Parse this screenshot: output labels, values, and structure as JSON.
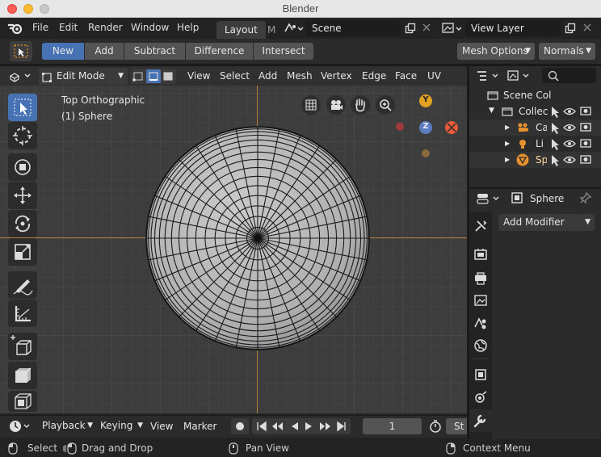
{
  "window": {
    "title": "Blender"
  },
  "menubar": {
    "items": [
      "File",
      "Edit",
      "Render",
      "Window",
      "Help"
    ],
    "workspace_tab": "Layout",
    "workspace_tab_next": "M",
    "scene": "Scene",
    "view_layer": "View Layer"
  },
  "toolheader": {
    "boolean_modes": [
      "New",
      "Add",
      "Subtract",
      "Difference",
      "Intersect"
    ],
    "active_mode": "New",
    "mesh_options": "Mesh Options",
    "normals": "Normals"
  },
  "viewport_header": {
    "mode": "Edit Mode",
    "menus": [
      "View",
      "Select",
      "Add",
      "Mesh",
      "Vertex",
      "Edge",
      "Face",
      "UV"
    ]
  },
  "viewport": {
    "view_name": "Top Orthographic",
    "object_label": "(1) Sphere",
    "gizmo_axes": [
      "Y",
      "Z",
      "X"
    ]
  },
  "timeline": {
    "menus": [
      "Playback",
      "Keying",
      "View",
      "Marker"
    ],
    "current_frame": "1",
    "start_label": "St"
  },
  "outliner": {
    "scene_collection": "Scene Col",
    "collection": "Collec",
    "items": [
      "Ca",
      "Li",
      "Sp"
    ]
  },
  "properties": {
    "object_name": "Sphere",
    "add_modifier": "Add Modifier"
  },
  "statusbar": {
    "select": "Select",
    "drag": "Drag and Drop",
    "pan": "Pan View",
    "context": "Context Menu"
  },
  "colors": {
    "accent_blue": "#4772b3",
    "axis_x": "#e55a3a",
    "axis_y": "#e0a020",
    "axis_z": "#5a7dbf",
    "object_orange": "#e7922e"
  }
}
